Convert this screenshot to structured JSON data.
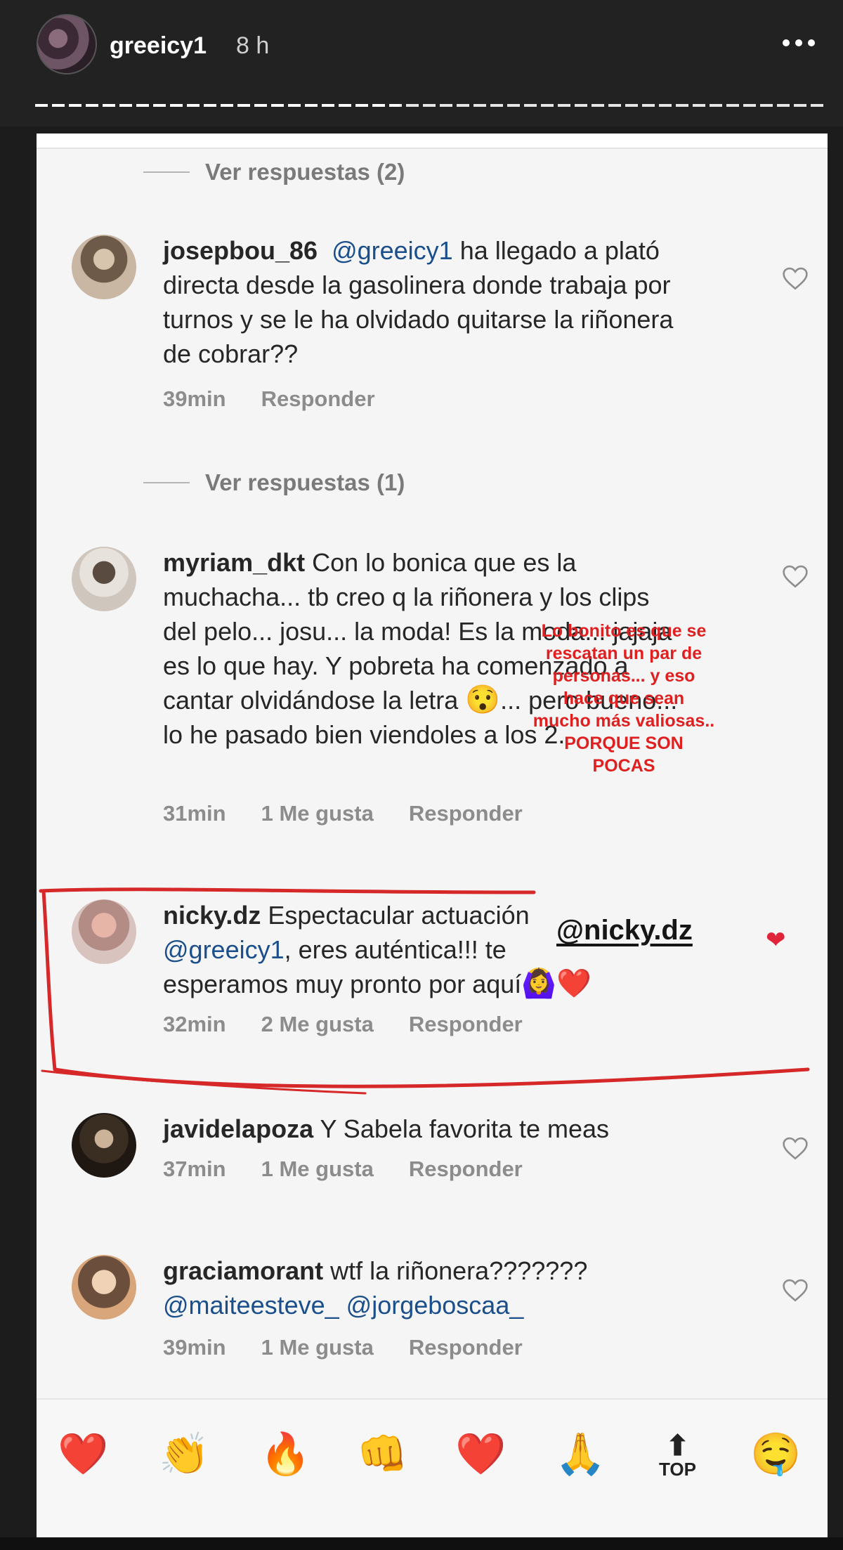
{
  "story": {
    "username": "greeicy1",
    "time": "8 h",
    "progress": 0.46
  },
  "threads": [
    {
      "replies_label": "Ver respuestas (2)"
    },
    {
      "replies_label": "Ver respuestas (1)"
    }
  ],
  "comments": [
    {
      "user": "josepbou_86",
      "mention": "@greeicy1",
      "text_after_mention": " ha llegado a plató directa desde la gasolinera donde trabaja por turnos y se le ha olvidado quitarse la riñonera de cobrar??",
      "time": "39min",
      "likes": "",
      "reply": "Responder"
    },
    {
      "user": "myriam_dkt",
      "text": " Con lo bonica que es la muchacha... tb creo q la riñonera y los clips  del pelo... josu... la moda! Es la moda... jajaja es lo que hay. Y pobreta ha comenzado a cantar olvidándose  la letra ",
      "emoji": "😯",
      "text_end": "... pero bueno... lo he pasado bien viendoles a los 2.",
      "time": "31min",
      "likes": "1 Me gusta",
      "reply": "Responder"
    },
    {
      "user": "nicky.dz",
      "text_before": " Espectacular actuación ",
      "mention": "@greeicy1",
      "text_after": ", eres auténtica!!! te esperamos muy pronto por aquí",
      "emoji": "🙆‍♀️❤️",
      "time": "32min",
      "likes": "2 Me gusta",
      "reply": "Responder"
    },
    {
      "user": "javidelapoza",
      "text": " Y Sabela favorita te meas",
      "time": "37min",
      "likes": "1 Me gusta",
      "reply": "Responder"
    },
    {
      "user": "graciamorant",
      "text": " wtf la riñonera???????",
      "mentions": "@maiteesteve_ @jorgeboscaa_",
      "time": "39min",
      "likes": "1 Me gusta",
      "reply": "Responder"
    }
  ],
  "annotation": {
    "note": "Lo bonito es que se rescatan un par de personas... y eso hace que sean mucho más valiosas.. PORQUE SON POCAS",
    "tag": "@nicky.dz",
    "highlight_color": "#d62828"
  },
  "reactions": {
    "emojis": [
      "❤️",
      "👏",
      "🔥",
      "👊",
      "❤️",
      "🙏",
      "",
      "🤤"
    ],
    "top_label": "TOP",
    "top_arrow": "⬆"
  }
}
